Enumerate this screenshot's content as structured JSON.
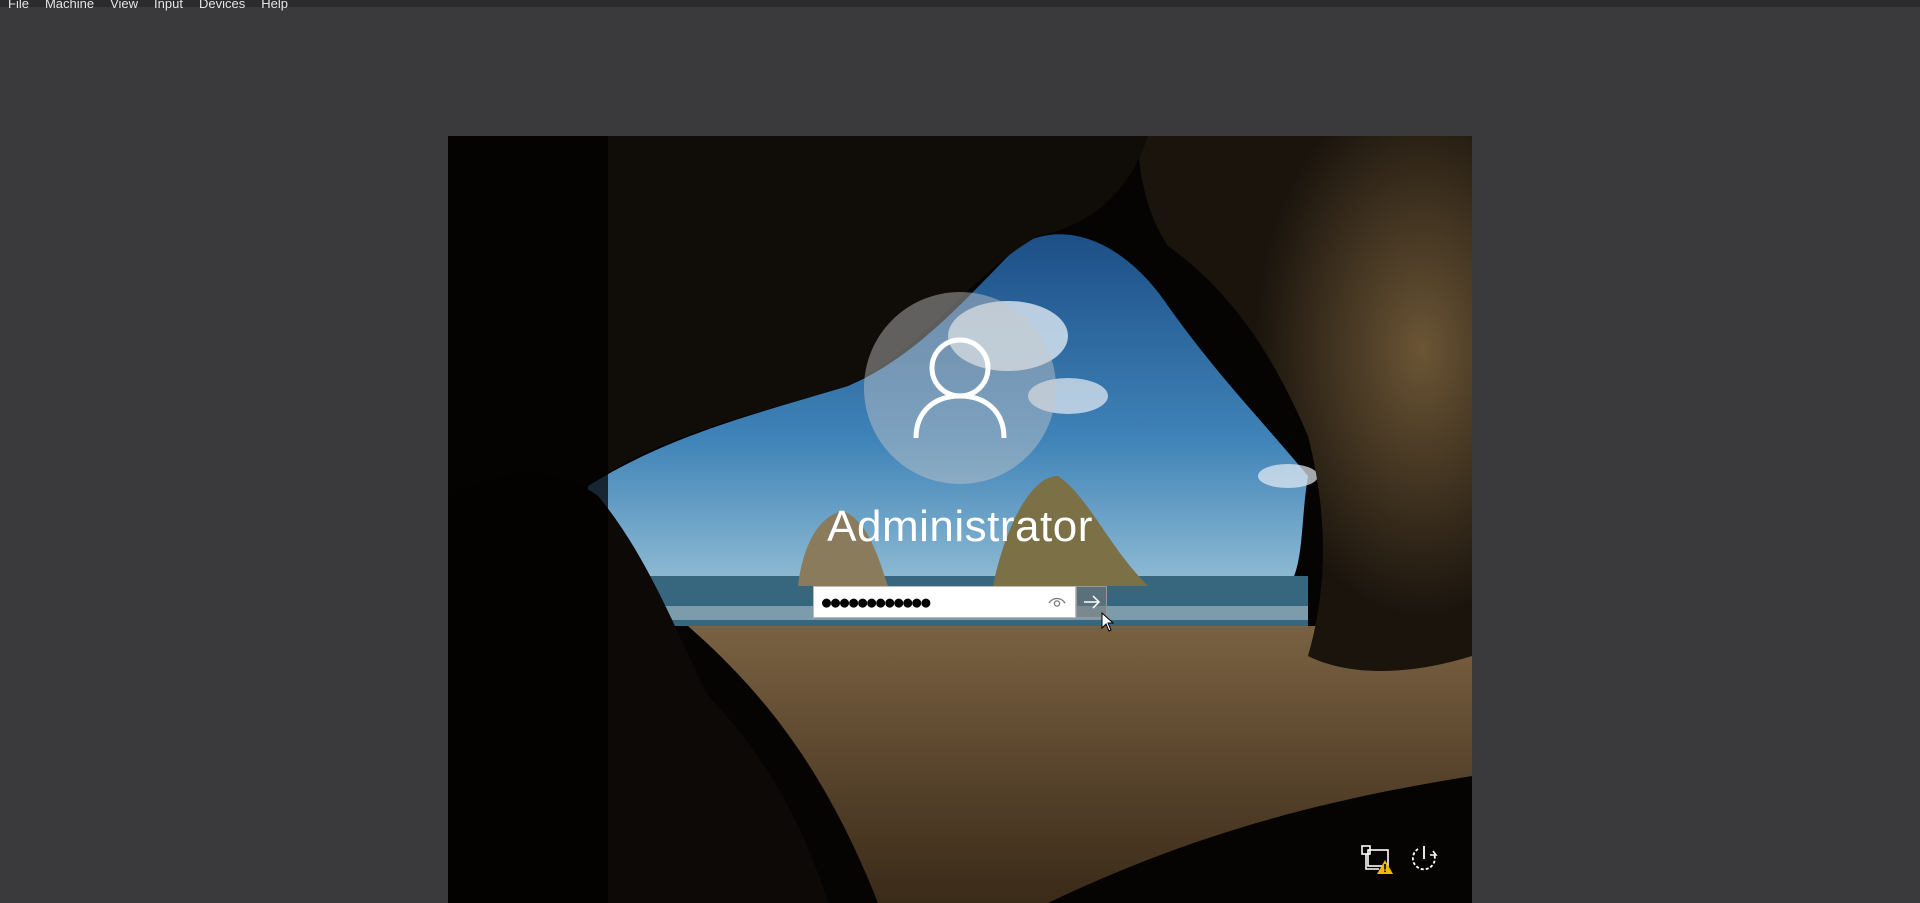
{
  "menubar": {
    "items": [
      "File",
      "Machine",
      "View",
      "Input",
      "Devices",
      "Help"
    ]
  },
  "login": {
    "username": "Administrator",
    "password_masked": "●●●●●●●●●●●●"
  },
  "icons": {
    "user": "user-icon",
    "reveal": "eye-icon",
    "submit": "arrow-right-icon",
    "network": "network-warning-icon",
    "power": "power-icon"
  },
  "colors": {
    "frame": "#3a3a3c",
    "warning": "#f5b800"
  }
}
